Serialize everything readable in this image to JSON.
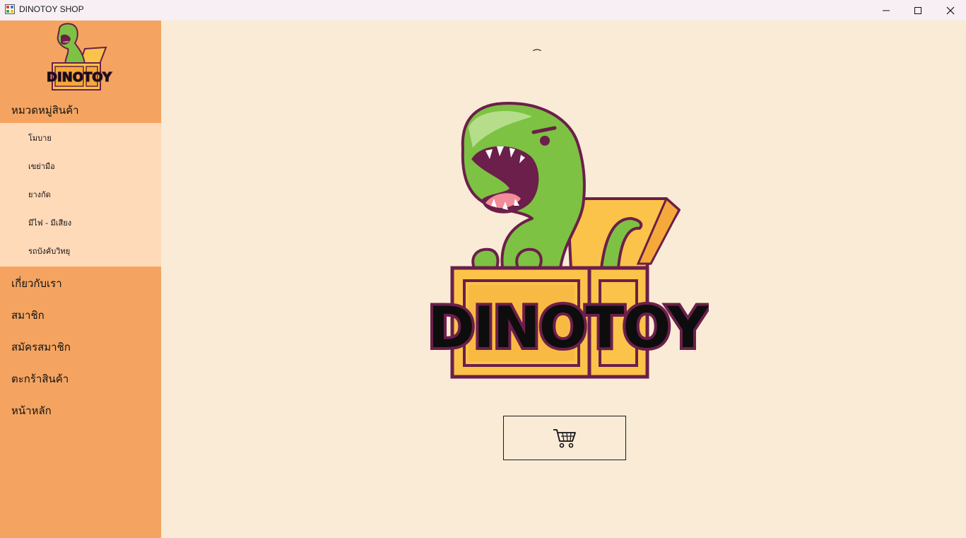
{
  "window": {
    "title": "DINOTOY SHOP"
  },
  "sidebar": {
    "logo_text": "DINOTOY",
    "category_header": "หมวดหมู่สินค้า",
    "sub_items": [
      {
        "label": "โมบาย"
      },
      {
        "label": "เขย่ามือ"
      },
      {
        "label": "ยางกัด"
      },
      {
        "label": "มีไฟ - มีเสียง"
      },
      {
        "label": "รถบังคับวิทยุ"
      }
    ],
    "menu_items": [
      {
        "label": "เกี่ยวกับเรา"
      },
      {
        "label": "สมาชิก"
      },
      {
        "label": "สมัครสมาชิก"
      },
      {
        "label": "ตะกร้าสินค้า"
      },
      {
        "label": "หน้าหลัก"
      }
    ]
  },
  "main": {
    "hero_logo_text": "DINOTOY",
    "cart_button_icon": "cart-icon"
  },
  "colors": {
    "sidebar": "#f4a460",
    "submenu": "#ffdab9",
    "main_bg": "#faebd7",
    "titlebar": "#f7eff3",
    "dino_green": "#7dc242",
    "box_yellow": "#fbc34a",
    "outline": "#6b1f4a"
  }
}
